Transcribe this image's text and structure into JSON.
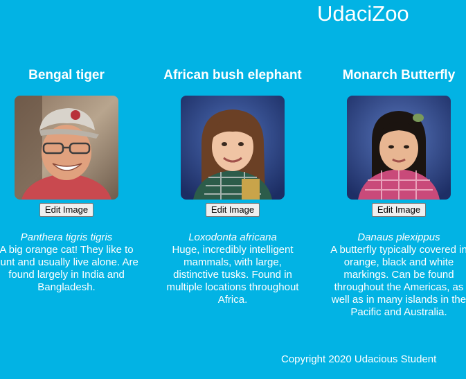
{
  "site": {
    "title": "UdaciZoo"
  },
  "animals": [
    {
      "title": "Bengal tiger",
      "button_label": "Edit Image",
      "scientific_name": "Panthera tigris tigris",
      "description": "A big orange cat! They like to hunt and usually live alone. Are found largely in India and Bangladesh.",
      "photo_icon": "person-photo"
    },
    {
      "title": "African bush elephant",
      "button_label": "Edit Image",
      "scientific_name": "Loxodonta africana",
      "description": "Huge, incredibly intelligent mammals, with large, distinctive tusks. Found in multiple locations throughout Africa.",
      "photo_icon": "person-photo"
    },
    {
      "title": "Monarch Butterfly",
      "button_label": "Edit Image",
      "scientific_name": "Danaus plexippus",
      "description": "A butterfly typically covered in orange, black and white markings. Can be found throughout the Americas, as well as in many islands in the Pacific and Australia.",
      "photo_icon": "person-photo"
    }
  ],
  "footer": {
    "copyright": "Copyright 2020 Udacious Student"
  },
  "colors": {
    "background": "#02b3e4",
    "text": "#ffffff",
    "button_bg": "#efefef"
  }
}
